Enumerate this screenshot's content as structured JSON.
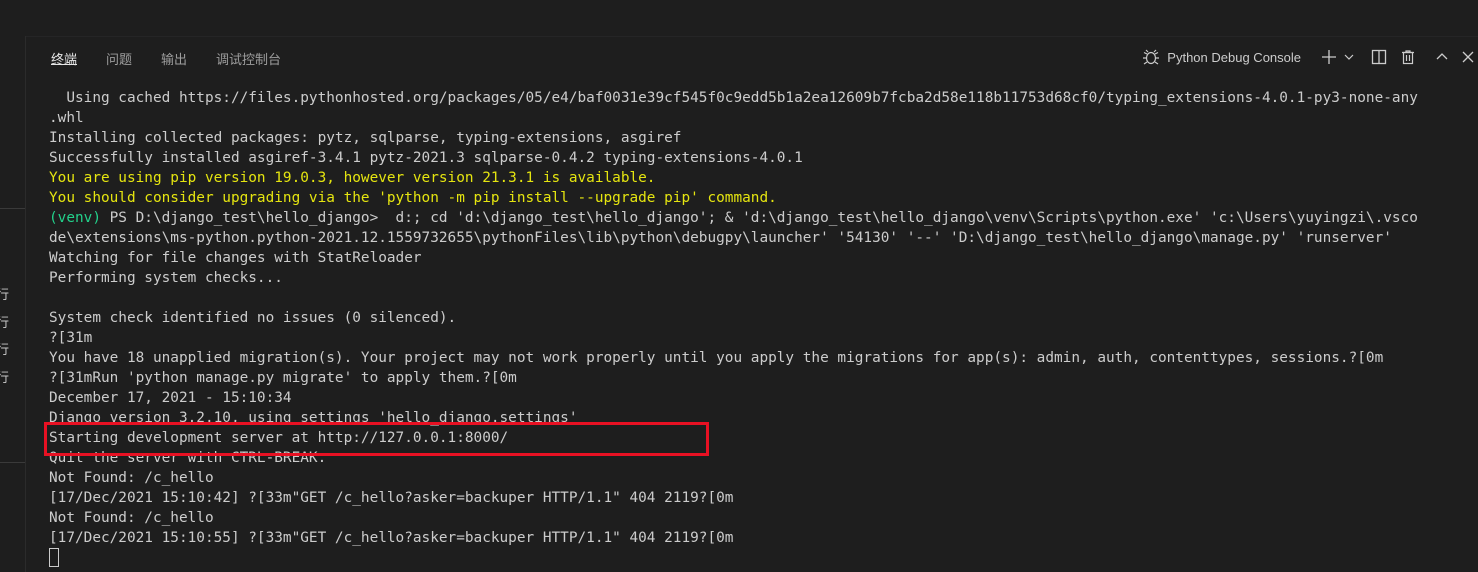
{
  "panel": {
    "tabs": [
      {
        "label": "终端",
        "active": true
      },
      {
        "label": "问题",
        "active": false
      },
      {
        "label": "输出",
        "active": false
      },
      {
        "label": "调试控制台",
        "active": false
      }
    ],
    "debug_console_label": "Python Debug Console",
    "action_icons": [
      "plus-icon",
      "chevron-down-icon",
      "split-icon",
      "trash-icon",
      "chevron-up-icon",
      "close-icon"
    ]
  },
  "left_gutter": {
    "chars": [
      "行",
      "行",
      "行",
      "行"
    ]
  },
  "terminal": {
    "lines": [
      {
        "text": "  Using cached https://files.pythonhosted.org/packages/05/e4/baf0031e39cf545f0c9edd5b1a2ea12609b7fcba2d58e118b11753d68cf0/typing_extensions-4.0.1-py3-none-any",
        "color": "default"
      },
      {
        "text": ".whl",
        "color": "default"
      },
      {
        "text": "Installing collected packages: pytz, sqlparse, typing-extensions, asgiref",
        "color": "default"
      },
      {
        "text": "Successfully installed asgiref-3.4.1 pytz-2021.3 sqlparse-0.4.2 typing-extensions-4.0.1",
        "color": "default"
      },
      {
        "text": "You are using pip version 19.0.3, however version 21.3.1 is available.",
        "color": "yellow"
      },
      {
        "text": "You should consider upgrading via the 'python -m pip install --upgrade pip' command.",
        "color": "yellow"
      },
      {
        "prefix": "(venv)",
        "text": " PS D:\\django_test\\hello_django>  d:; cd 'd:\\django_test\\hello_django'; & 'd:\\django_test\\hello_django\\venv\\Scripts\\python.exe' 'c:\\Users\\yuyingzi\\.vsco",
        "color": "default"
      },
      {
        "text": "de\\extensions\\ms-python.python-2021.12.1559732655\\pythonFiles\\lib\\python\\debugpy\\launcher' '54130' '--' 'D:\\django_test\\hello_django\\manage.py' 'runserver'",
        "color": "default"
      },
      {
        "text": "Watching for file changes with StatReloader",
        "color": "default"
      },
      {
        "text": "Performing system checks...",
        "color": "default"
      },
      {
        "text": "",
        "color": "default"
      },
      {
        "text": "System check identified no issues (0 silenced).",
        "color": "default"
      },
      {
        "text": "?[31m",
        "color": "default"
      },
      {
        "text": "You have 18 unapplied migration(s). Your project may not work properly until you apply the migrations for app(s): admin, auth, contenttypes, sessions.?[0m",
        "color": "default"
      },
      {
        "text": "?[31mRun 'python manage.py migrate' to apply them.?[0m",
        "color": "default"
      },
      {
        "text": "December 17, 2021 - 15:10:34",
        "color": "default"
      },
      {
        "text": "Django version 3.2.10, using settings 'hello_django.settings'",
        "color": "default"
      },
      {
        "text": "Starting development server at http://127.0.0.1:8000/",
        "color": "default"
      },
      {
        "text": "Quit the server with CTRL-BREAK.",
        "color": "default"
      },
      {
        "text": "Not Found: /c_hello",
        "color": "default"
      },
      {
        "text": "[17/Dec/2021 15:10:42] ?[33m\"GET /c_hello?asker=backuper HTTP/1.1\" 404 2119?[0m",
        "color": "default"
      },
      {
        "text": "Not Found: /c_hello",
        "color": "default"
      },
      {
        "text": "[17/Dec/2021 15:10:55] ?[33m\"GET /c_hello?asker=backuper HTTP/1.1\" 404 2119?[0m",
        "color": "default"
      }
    ]
  },
  "colors": {
    "background": "#1e1e1e",
    "text": "#cccccc",
    "warning_yellow": "#e5e510",
    "venv_green": "#23d18b",
    "highlight_red": "#e81123"
  }
}
